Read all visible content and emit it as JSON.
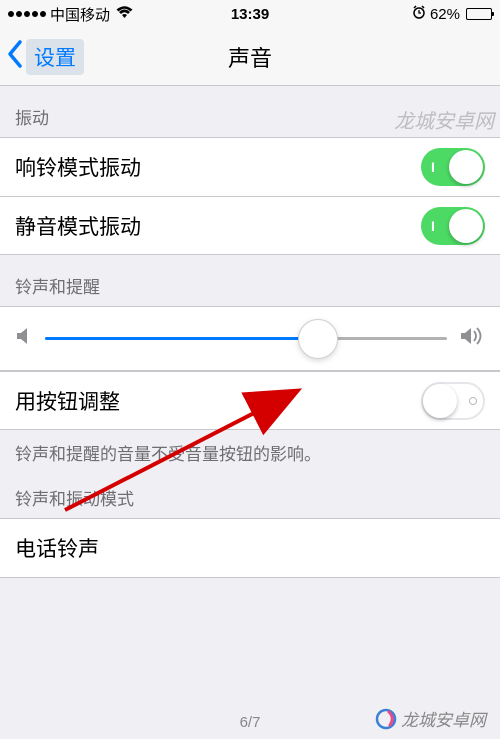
{
  "status_bar": {
    "carrier": "中国移动",
    "time": "13:39",
    "battery_pct": "62%",
    "battery_level": 62
  },
  "nav": {
    "back_label": "设置",
    "title": "声音"
  },
  "sections": {
    "vibration_header": "振动",
    "ring_vibrate_label": "响铃模式振动",
    "silent_vibrate_label": "静音模式振动",
    "ringer_header": "铃声和提醒",
    "change_with_buttons_label": "用按钮调整",
    "ringer_footer": "铃声和提醒的音量不受音量按钮的影响。",
    "pattern_header": "铃声和振动模式",
    "ringtone_label": "电话铃声"
  },
  "slider": {
    "value": 68
  },
  "toggles": {
    "ring_vibrate": true,
    "silent_vibrate": true,
    "change_with_buttons": false
  },
  "watermarks": {
    "top_right": "龙城安卓网",
    "bottom_right": "龙城安卓网"
  },
  "page_indicator": "6/7"
}
